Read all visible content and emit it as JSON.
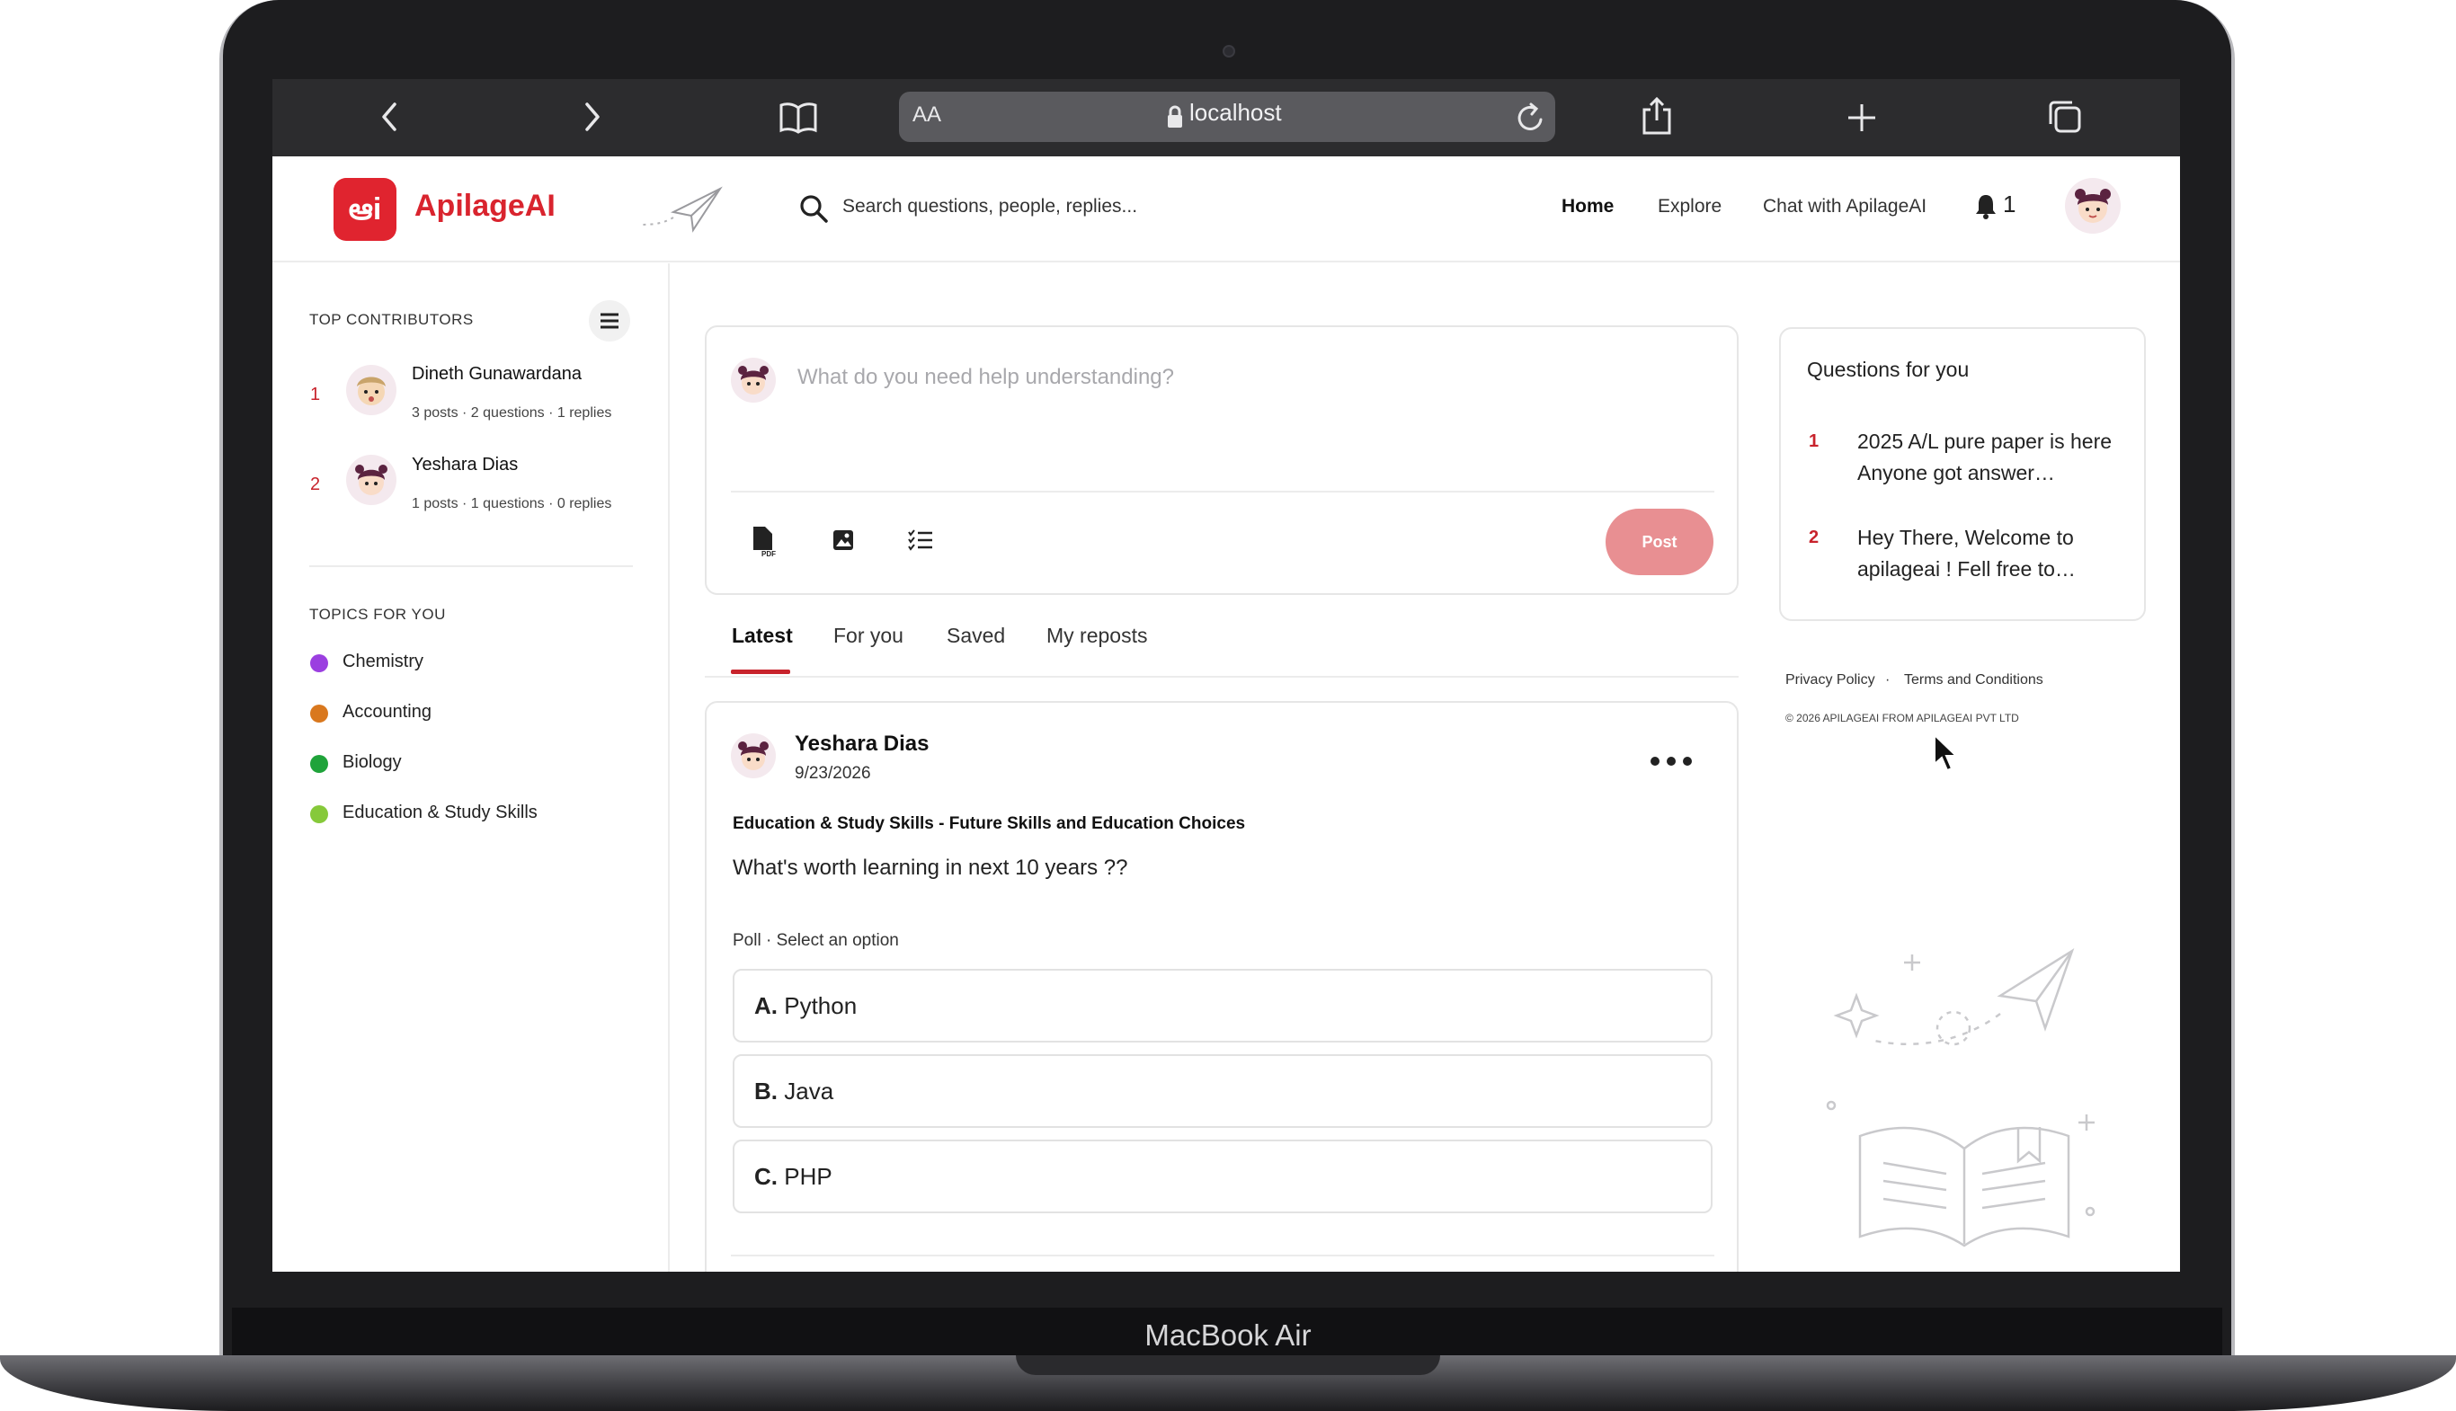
{
  "device": {
    "label": "MacBook Air"
  },
  "browser": {
    "text_size_label": "AA",
    "url": "localhost"
  },
  "app": {
    "logo_mark": "ఆi",
    "brand": "ApilageAI",
    "search_placeholder": "Search questions, people, replies...",
    "nav": {
      "home": "Home",
      "explore": "Explore",
      "chat": "Chat with ApilageAI"
    },
    "notification_count": "1"
  },
  "sidebar": {
    "contributors_title": "TOP CONTRIBUTORS",
    "contributors": [
      {
        "rank": "1",
        "name": "Dineth Gunawardana",
        "meta": "3 posts · 2 questions · 1 replies"
      },
      {
        "rank": "2",
        "name": "Yeshara Dias",
        "meta": "1 posts · 1 questions · 0 replies"
      }
    ],
    "topics_title": "TOPICS FOR YOU",
    "topics": [
      {
        "label": "Chemistry",
        "color": "#9b3fe0"
      },
      {
        "label": "Accounting",
        "color": "#d9781e"
      },
      {
        "label": "Biology",
        "color": "#1fa33a"
      },
      {
        "label": "Education & Study Skills",
        "color": "#86c93a"
      }
    ]
  },
  "composer": {
    "placeholder": "What do you need help understanding?",
    "post_label": "Post"
  },
  "tabs": [
    "Latest",
    "For you",
    "Saved",
    "My reposts"
  ],
  "post": {
    "author": "Yeshara Dias",
    "date": "9/23/2026",
    "topic": "Education & Study Skills - Future Skills and Education Choices",
    "body": "What's worth learning in next 10 years ??",
    "poll_label": "Poll · Select an option",
    "options": [
      {
        "letter": "A.",
        "text": "Python"
      },
      {
        "letter": "B.",
        "text": "Java"
      },
      {
        "letter": "C.",
        "text": "PHP"
      }
    ]
  },
  "questions": {
    "title": "Questions for you",
    "items": [
      {
        "num": "1",
        "text": "2025 A/L pure paper is here Anyone got answer…"
      },
      {
        "num": "2",
        "text": "Hey There, Welcome to apilageai ! Fell free to…"
      }
    ]
  },
  "footer": {
    "privacy": "Privacy Policy",
    "separator": "·",
    "terms": "Terms and Conditions",
    "copyright": "© 2026 APILAGEAI FROM APILAGEAI PVT LTD"
  }
}
